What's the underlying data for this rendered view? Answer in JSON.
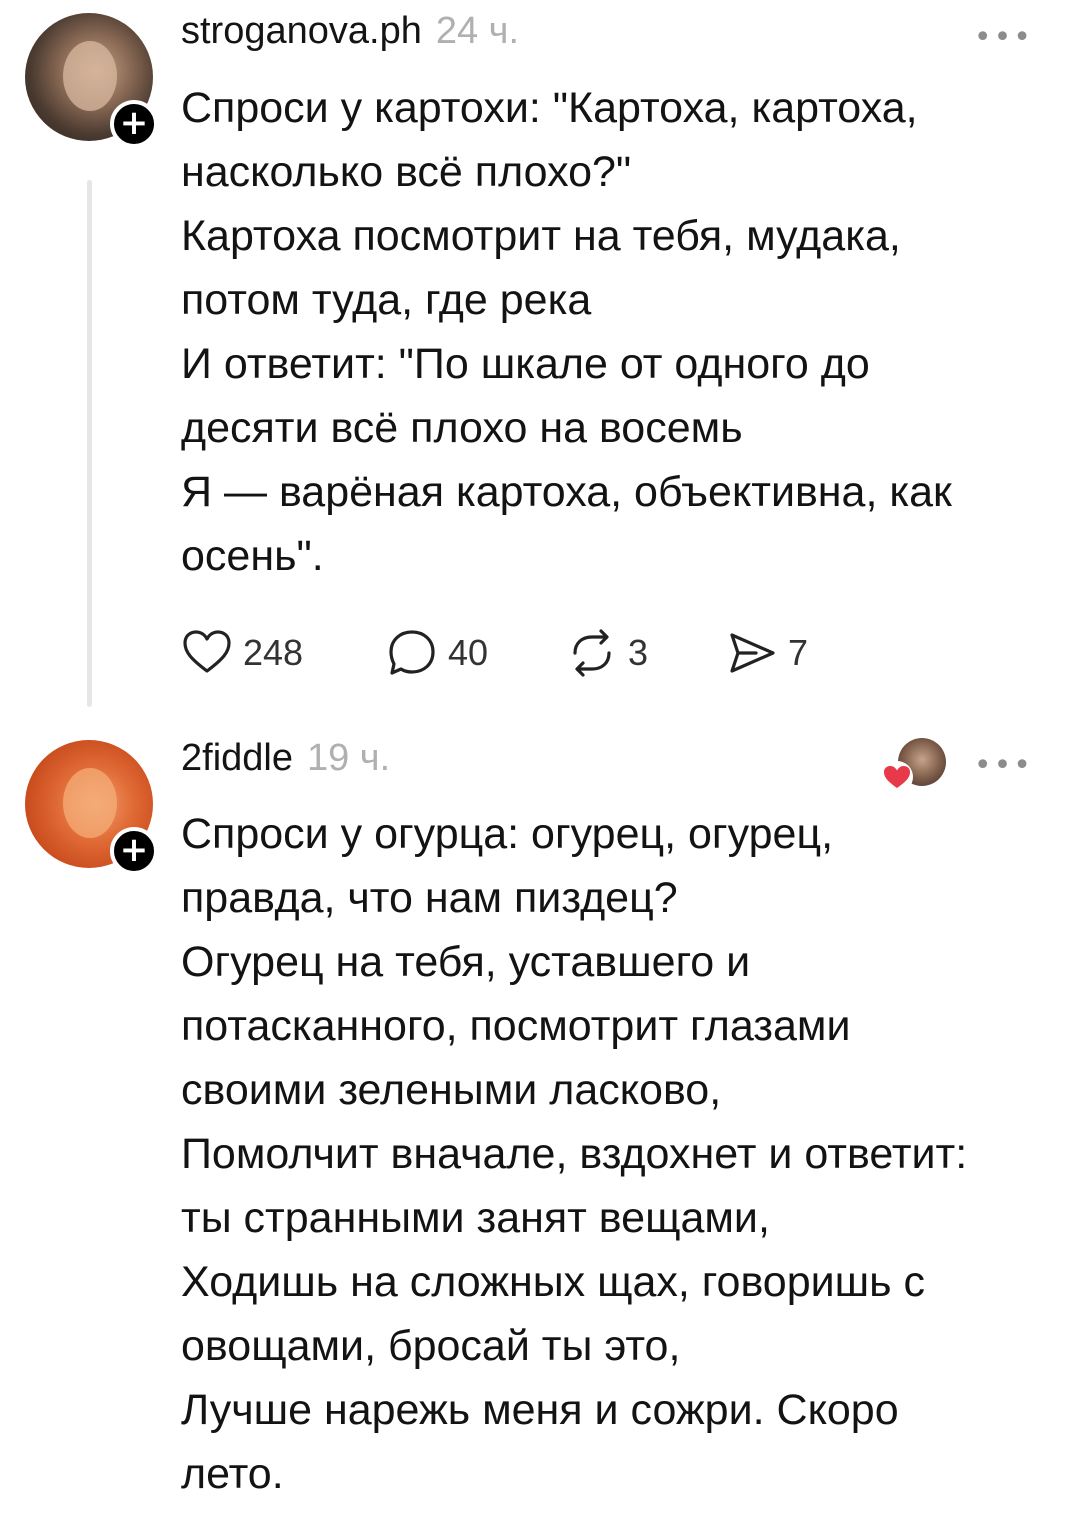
{
  "posts": [
    {
      "username": "stroganova.ph",
      "time": "24 ч.",
      "more": "•••",
      "lines": [
        "Спроси у картохи: \"Картоха, картоха,",
        "насколько всё плохо?\"",
        "Картоха посмотрит на тебя, мудака,",
        "потом туда, где река",
        "И ответит: \"По шкале от одного до",
        "десяти всё плохо на восемь",
        "Я — варёная картоха, объективна, как",
        "осень\"."
      ],
      "actions": {
        "likes": "248",
        "comments": "40",
        "reposts": "3",
        "shares": "7"
      }
    },
    {
      "username": "2fiddle",
      "time": "19 ч.",
      "more": "•••",
      "lines": [
        "Спроси у огурца: огурец, огурец,",
        "правда, что нам пиздец?",
        "Огурец на тебя, уставшего и",
        "потасканного, посмотрит глазами",
        "своими зелеными ласково,",
        "Помолчит вначале, вздохнет и ответит:",
        "ты странными занят вещами,",
        "Ходишь на сложных щах, говоришь с",
        "овощами, бросай ты это,",
        "Лучше нарежь меня и сожри. Скоро",
        "лето."
      ]
    }
  ],
  "icons": {
    "follow": "+",
    "like": "heart-outline-icon",
    "comment": "speech-bubble-icon",
    "repost": "repost-arrows-icon",
    "share": "paper-plane-icon",
    "liked_by": "red-heart-icon"
  },
  "colors": {
    "text": "#131313",
    "muted": "#b0b0b0",
    "heart": "#e8394a"
  }
}
